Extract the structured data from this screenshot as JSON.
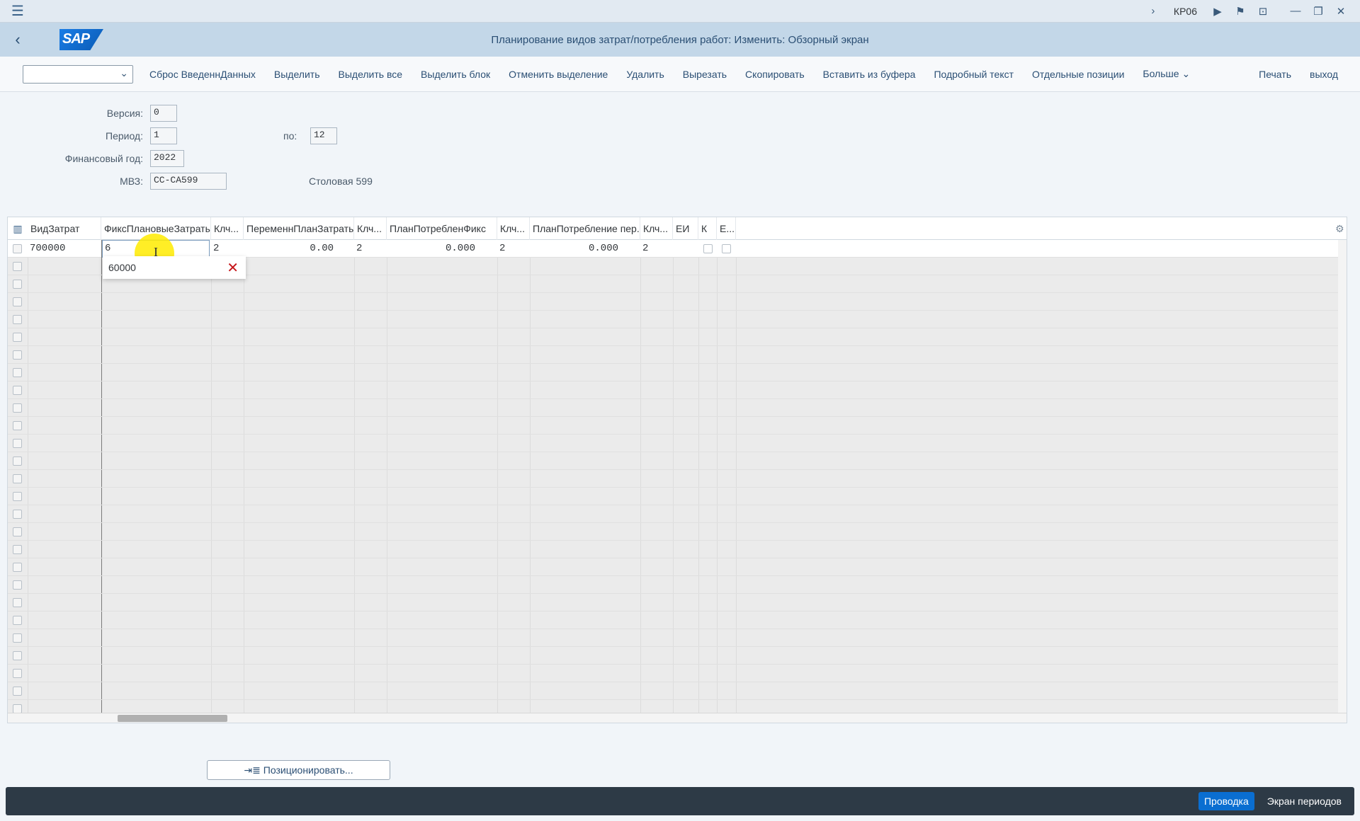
{
  "topbar": {
    "tcode": "КР06"
  },
  "shell": {
    "title": "Планирование видов затрат/потребления работ: Изменить: Обзорный экран",
    "logo": "SAP"
  },
  "toolbar": {
    "select_value": "",
    "buttons": [
      "Сброс ВведеннДанных",
      "Выделить",
      "Выделить все",
      "Выделить блок",
      "Отменить выделение",
      "Удалить",
      "Вырезать",
      "Скопировать",
      "Вставить из буфера",
      "Подробный текст",
      "Отдельные позиции",
      "Больше"
    ],
    "right_buttons": [
      "Печать",
      "выход"
    ]
  },
  "form": {
    "version_label": "Версия:",
    "version_value": "0",
    "period_label": "Период:",
    "period_value": "1",
    "to_label": "по:",
    "to_value": "12",
    "fy_label": "Финансовый год:",
    "fy_value": "2022",
    "cc_label": "МВЗ:",
    "cc_value": "CC-CA599",
    "cc_text": "Столовая 599"
  },
  "table": {
    "headers": [
      "ВидЗатрат",
      "ФиксПлановыеЗатраты",
      "Клч...",
      "ПеременнПланЗатраты",
      "Клч...",
      "ПланПотребленФикс",
      "Клч...",
      "ПланПотребление пер.",
      "Клч...",
      "ЕИ",
      "К",
      "Е..."
    ],
    "row1": {
      "cost_element": "700000",
      "fixed_cost": "6",
      "key1": "2",
      "var_cost": "0.00",
      "key2": "2",
      "plan_fix": "0.000",
      "key3": "2",
      "plan_var": "0.000",
      "key4": "2"
    }
  },
  "autocomplete": {
    "value": "60000"
  },
  "position_button": "Позиционировать...",
  "footer": {
    "primary": "Проводка",
    "secondary": "Экран периодов"
  }
}
